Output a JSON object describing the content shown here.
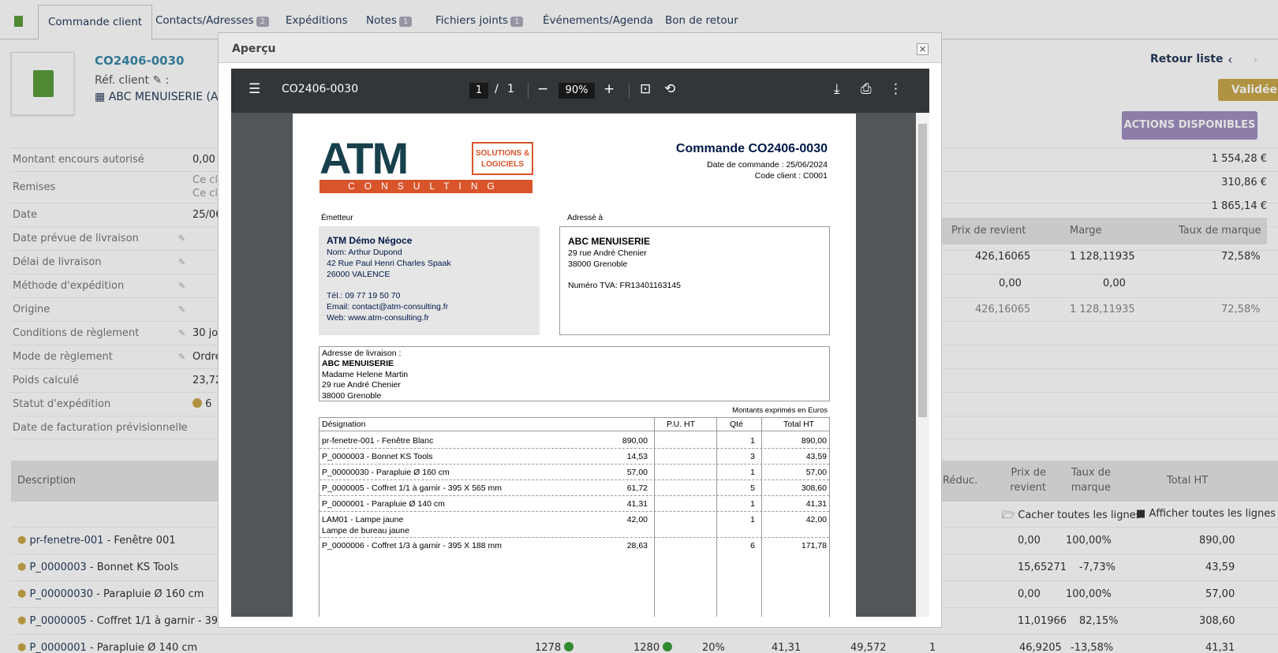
{
  "tabs": [
    {
      "label": "Commande client",
      "count": ""
    },
    {
      "label": "Contacts/Adresses",
      "count": "2"
    },
    {
      "label": "Expéditions",
      "count": ""
    },
    {
      "label": "Notes",
      "count": "1"
    },
    {
      "label": "Fichiers joints",
      "count": "1"
    },
    {
      "label": "Événements/Agenda",
      "count": ""
    },
    {
      "label": "Bon de retour",
      "count": ""
    }
  ],
  "header": {
    "ref": "CO2406-0030",
    "ref_client_label": "Réf. client",
    "ref_client_colon": ":",
    "thirdparty": "ABC MENUISERIE (A",
    "back_link": "Retour liste",
    "prev": "‹",
    "next": "›",
    "status": "Validée",
    "actions_button": "ACTIONS DISPONIBLES"
  },
  "fields": [
    {
      "label": "Montant encours autorisé",
      "value": "0,00"
    },
    {
      "label": "Remises",
      "value": "Ce cl",
      "value2": "Ce cl"
    },
    {
      "label": "Date",
      "value": "25/06"
    },
    {
      "label": "Date prévue de livraison",
      "value": ""
    },
    {
      "label": "Délai de livraison",
      "value": ""
    },
    {
      "label": "Méthode d'expédition",
      "value": ""
    },
    {
      "label": "Origine",
      "value": ""
    },
    {
      "label": "Conditions de règlement",
      "value": "30 jou"
    },
    {
      "label": "Mode de règlement",
      "value": "Ordre"
    },
    {
      "label": "Poids calculé",
      "value": "23,72"
    },
    {
      "label": "Statut d'expédition",
      "value": "6"
    },
    {
      "label": "Date de facturation prévisionnelle",
      "value": ""
    }
  ],
  "totals": [
    "1 554,28 €",
    "310,86 €",
    "1 865,14 €"
  ],
  "margin": {
    "headers": [
      "Prix de revient",
      "Marge",
      "Taux de marque"
    ],
    "rows": [
      [
        "426,16065",
        "1 128,11935",
        "72,58%"
      ],
      [
        "0,00",
        "0,00",
        ""
      ],
      [
        "426,16065",
        "1 128,11935",
        "72,58%"
      ]
    ]
  },
  "lines_header": {
    "description": "Description",
    "reduc": "Réduc.",
    "cost": "Prix de",
    "cost2": "revient",
    "rate": "Taux de",
    "rate2": "marque",
    "total": "Total HT"
  },
  "toggle": {
    "hide": "Cacher toutes les lignes",
    "show": "Afficher toutes les lignes"
  },
  "lines": [
    {
      "ref": "pr-fenetre-001",
      "label": " - Fenêtre 001",
      "cost": "0,00",
      "rate": "100,00%",
      "total": "890,00"
    },
    {
      "ref": "P_0000003",
      "label": " - Bonnet KS Tools",
      "cost": "15,65271",
      "rate": "-7,73%",
      "total": "43,59"
    },
    {
      "ref": "P_00000030",
      "label": " - Parapluie Ø 160 cm",
      "cost": "0,00",
      "rate": "100,00%",
      "total": "57,00"
    },
    {
      "ref": "P_0000005",
      "label": " - Coffret 1/1 à garnir - 395 X",
      "cost": "11,01966",
      "rate": "82,15%",
      "total": "308,60"
    },
    {
      "ref": "P_0000001",
      "label": " - Parapluie Ø 140 cm",
      "cost": "46,9205",
      "rate": "-13,58%",
      "total": "41,31",
      "stock1": "1278",
      "stock2": "1280",
      "vat": "20%",
      "pu": "41,31",
      "pu2": "49,572",
      "qty": "1"
    }
  ],
  "modal": {
    "title": "Aperçu",
    "close": "×"
  },
  "viewer": {
    "filename": "CO2406-0030",
    "page": "1",
    "sep": "/",
    "pages": "1",
    "zoom": "90%"
  },
  "pdf": {
    "logo_main": "ATM",
    "logo_sub": "CONSULTING",
    "logo_tag1": "SOLUTIONS &",
    "logo_tag2": "LOGICIELS",
    "title": "Commande CO2406-0030",
    "date": "Date de commande : 25/06/2024",
    "client_code": "Code client : C0001",
    "issuer_label": "Émetteur",
    "addressee_label": "Adressé à",
    "issuer": [
      "ATM Démo Négoce",
      "Nom: Arthur Dupond",
      "42 Rue Paul Henri Charles Spaak",
      "26000 VALENCE",
      "",
      "Tél.: 09 77 19 50 70",
      "Email: contact@atm-consulting.fr",
      "Web: www.atm-consulting.fr"
    ],
    "recipient": [
      "ABC MENUISERIE",
      "29 rue André Chenier",
      "38000 Grenoble",
      "",
      "Numéro TVA: FR13401163145"
    ],
    "delivery_label": "Adresse de livraison :",
    "delivery": [
      "ABC MENUISERIE",
      "Madame Helene Martin",
      "29 rue André Chenier",
      "38000 Grenoble"
    ],
    "currency": "Montants exprimés en Euros",
    "cols": [
      "Désignation",
      "P.U. HT",
      "Qté",
      "Total HT"
    ],
    "rows": [
      {
        "d": "pr-fenetre-001 - Fenêtre Blanc",
        "d2": "",
        "pu": "890,00",
        "q": "1",
        "t": "890,00"
      },
      {
        "d": "P_0000003 - Bonnet KS Tools",
        "d2": "",
        "pu": "14,53",
        "q": "3",
        "t": "43,59"
      },
      {
        "d": "P_00000030 - Parapluie Ø 160 cm",
        "d2": "",
        "pu": "57,00",
        "q": "1",
        "t": "57,00"
      },
      {
        "d": "P_0000005 - Coffret 1/1 à garnir - 395 X 565 mm",
        "d2": "",
        "pu": "61,72",
        "q": "5",
        "t": "308,60"
      },
      {
        "d": "P_0000001 - Parapluie Ø 140 cm",
        "d2": "",
        "pu": "41,31",
        "q": "1",
        "t": "41,31"
      },
      {
        "d": "LAM01 - Lampe jaune",
        "d2": "Lampe de bureau jaune",
        "pu": "42,00",
        "q": "1",
        "t": "42,00"
      },
      {
        "d": "P_0000006 - Coffret 1/3 à garnir - 395 X 188 mm",
        "d2": "",
        "pu": "28,63",
        "q": "6",
        "t": "171,78"
      }
    ]
  }
}
